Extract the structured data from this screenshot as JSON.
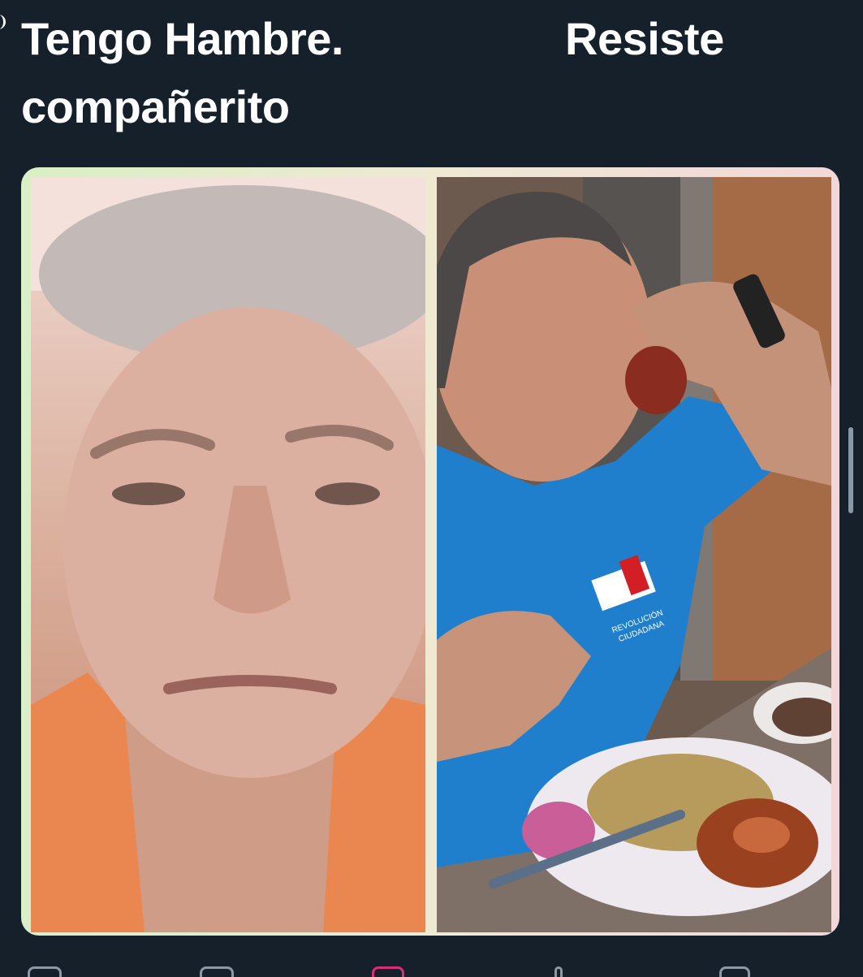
{
  "post": {
    "caption_left_line1": "Tengo Hambre.",
    "caption_left_line2": "compañerito",
    "caption_right": "Resiste"
  },
  "media": {
    "left_panel_icon": "photo-icon",
    "right_panel_icon": "photo-icon",
    "shirt_logo_line1": "REVOLUCIÓN",
    "shirt_logo_line2": "CIUDADANA"
  },
  "actions": {
    "reply_icon": "reply-icon",
    "repost_icon": "repost-icon",
    "like_icon": "heart-icon",
    "views_icon": "views-icon",
    "share_icon": "share-icon"
  },
  "colors": {
    "background": "#15202b",
    "text": "#ffffff",
    "muted": "#8b98a5"
  }
}
